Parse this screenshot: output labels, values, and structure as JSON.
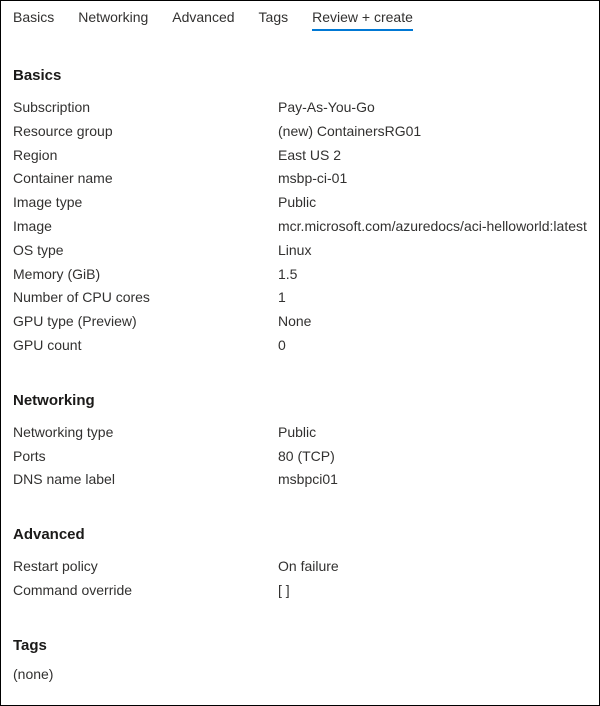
{
  "tabs": {
    "basics": "Basics",
    "networking": "Networking",
    "advanced": "Advanced",
    "tags": "Tags",
    "review": "Review + create"
  },
  "sections": {
    "basics": {
      "title": "Basics",
      "rows": {
        "subscription_k": "Subscription",
        "subscription_v": "Pay-As-You-Go",
        "rg_k": "Resource group",
        "rg_v": "(new) ContainersRG01",
        "region_k": "Region",
        "region_v": "East US 2",
        "cname_k": "Container name",
        "cname_v": "msbp-ci-01",
        "imgtype_k": "Image type",
        "imgtype_v": "Public",
        "image_k": "Image",
        "image_v": "mcr.microsoft.com/azuredocs/aci-helloworld:latest",
        "os_k": "OS type",
        "os_v": "Linux",
        "mem_k": "Memory (GiB)",
        "mem_v": "1.5",
        "cpu_k": "Number of CPU cores",
        "cpu_v": "1",
        "gpu_k": "GPU type (Preview)",
        "gpu_v": "None",
        "gpucount_k": "GPU count",
        "gpucount_v": "0"
      }
    },
    "networking": {
      "title": "Networking",
      "rows": {
        "ntype_k": "Networking type",
        "ntype_v": "Public",
        "ports_k": "Ports",
        "ports_v": "80 (TCP)",
        "dns_k": "DNS name label",
        "dns_v": "msbpci01"
      }
    },
    "advanced": {
      "title": "Advanced",
      "rows": {
        "restart_k": "Restart policy",
        "restart_v": "On failure",
        "cmd_k": "Command override",
        "cmd_v": "[ ]"
      }
    },
    "tags": {
      "title": "Tags",
      "none": "(none)"
    }
  }
}
